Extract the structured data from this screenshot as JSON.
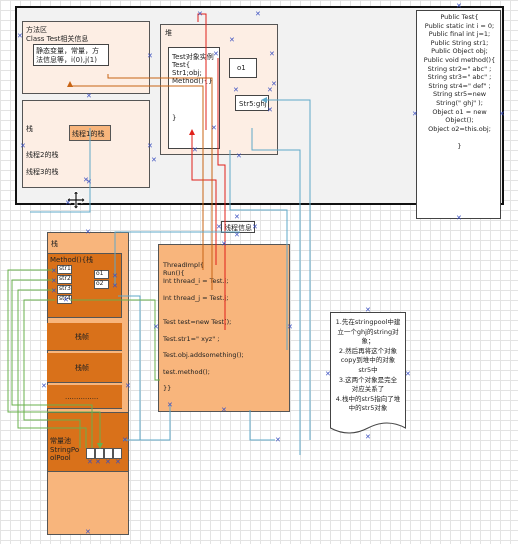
{
  "method_area": {
    "label": "方法区",
    "class_info": "Class Test相关信息",
    "static_box": [
      "静态变量，常量，方",
      "法信息等，i(0),j(1)"
    ],
    "thread_label": "栈",
    "thread1_box": "线程1的栈",
    "thread2": "线程2的栈",
    "thread3": "线程3的栈"
  },
  "heap": {
    "label": "堆",
    "instance": [
      "Test对象实例",
      "Test{",
      "Str1;obj;",
      "Method(){}",
      "}"
    ],
    "o1": "o1",
    "str5": "Str5:ghj"
  },
  "java_code": [
    "Public Test{",
    "Public static int i = 0;",
    "Public final int j=1;",
    "Public String str1;",
    "Public Object obj;",
    "Public void method(){",
    "String str2=\" abc\" ;",
    "String str3=\" abc\" ;",
    "String str4=\" def\" ;",
    "String str5=new",
    "String(\" ghj\" );",
    "Object o1 = new",
    "Object();",
    "Object o2=this.obj;",
    "",
    "}"
  ],
  "stack": {
    "label": "栈",
    "method_label": "Method(){栈",
    "frame_cells": [
      "str1",
      "str2",
      "str3",
      "str4",
      "o1",
      "o2"
    ],
    "rows": [
      "栈帧",
      "栈帧",
      "..............."
    ],
    "constant_pool_label": [
      "常量池",
      "StringPo",
      "olPool"
    ],
    "pool_cells": [
      "",
      "",
      "",
      ""
    ]
  },
  "thread_code": [
    "ThreadImpl{",
    "Run(){",
    "Int thread_i = Test.i;",
    "",
    "Int thread_j = Test.j;",
    "",
    "",
    "Test test=new Test();",
    "",
    "Test.str1=\" xyz\" ;",
    "",
    "Test.obj.addsomething();",
    "",
    "test.method();",
    "",
    "}}"
  ],
  "stack_info_label": "线程信息",
  "note": [
    "1.先在stringpool中建",
    "立一个ghj的string对",
    "象；",
    "2.然后再将这个对象",
    "copy到堆中的对象",
    "str5中",
    "3.这两个对象是完全",
    "对应关系了",
    "4.栈中的str5指向了堆",
    "中的str5对象"
  ],
  "colors": {
    "peach": "#fdeee4",
    "orange": "#f8b57c",
    "dark_orange": "#d9711a",
    "red_arrow": "#e0201a",
    "blue_arrow": "#5fa8c8",
    "green_arrow": "#6ab04c"
  }
}
